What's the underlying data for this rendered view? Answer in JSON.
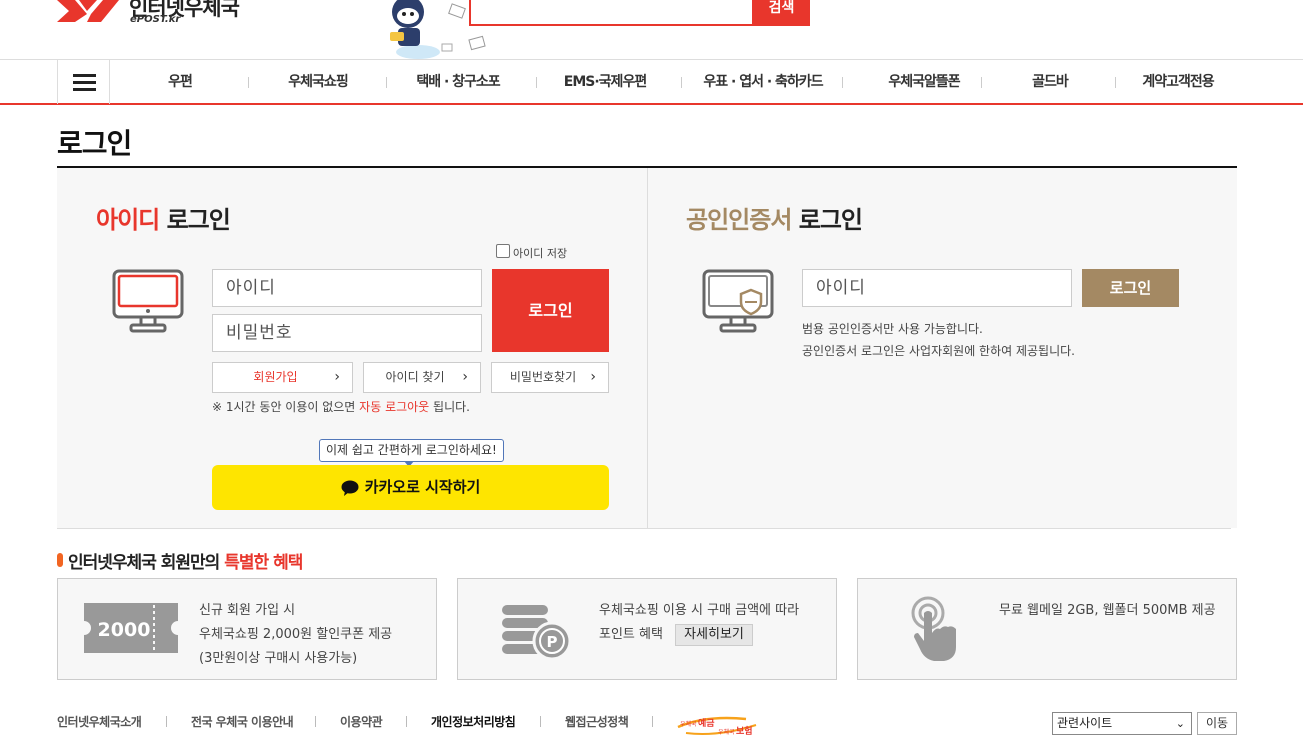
{
  "header": {
    "logo_text": "인터넷우체국",
    "logo_sub": "ePOST.kr",
    "search_button": "검색"
  },
  "nav": {
    "items": [
      "우편",
      "우체국쇼핑",
      "택배 · 창구소포",
      "EMS·국제우편",
      "우표 · 엽서 · 축하카드",
      "우체국알뜰폰",
      "골드바",
      "계약고객전용"
    ]
  },
  "page_title": "로그인",
  "id_login": {
    "title_highlight": "아이디",
    "title_rest": " 로그인",
    "save_id_label": "아이디 저장",
    "id_placeholder": "아이디",
    "pw_placeholder": "비밀번호",
    "login_button": "로그인",
    "join_button": "회원가입",
    "find_id_button": "아이디 찾기",
    "find_pw_button": "비밀번호찾기",
    "notice_pre": "※ 1시간 동안 이용이 없으면 ",
    "notice_highlight": "자동 로그아웃",
    "notice_post": " 됩니다.",
    "kakao_bubble": "이제 쉽고 간편하게 로그인하세요!",
    "kakao_button": "카카오로 시작하기"
  },
  "cert_login": {
    "title_highlight": "공인인증서",
    "title_rest": " 로그인",
    "id_placeholder": "아이디",
    "login_button": "로그인",
    "info_line1": "범용 공인인증서만 사용 가능합니다.",
    "info_line2": "공인인증서 로그인은 사업자회원에 한하여 제공됩니다."
  },
  "benefits": {
    "title_pre": "인터넷우체국 회원만의 ",
    "title_highlight": "특별한 혜택",
    "coupon_amount": "2000",
    "box1": [
      "신규 회원 가입 시",
      "우체국쇼핑 2,000원 할인쿠폰 제공",
      "(3만원이상 구매시 사용가능)"
    ],
    "box2_line1": "우체국쇼핑 이용 시 구매 금액에 따라",
    "box2_line2": "포인트 혜택",
    "box2_button": "자세히보기",
    "box3": "무료 웹메일 2GB, 웹폴더 500MB 제공"
  },
  "footer": {
    "links": [
      "인터넷우체국소개",
      "전국 우체국 이용안내",
      "이용약관",
      "개인정보처리방침",
      "웹접근성정책"
    ],
    "banner_text1": "우체국",
    "banner_text2": "예금",
    "banner_text3": "우체국",
    "banner_text4": "보험",
    "select_value": "관련사이트",
    "go_button": "이동"
  },
  "colors": {
    "brand_red": "#e8362c",
    "gold": "#a48963",
    "kakao_yellow": "#fee500"
  }
}
